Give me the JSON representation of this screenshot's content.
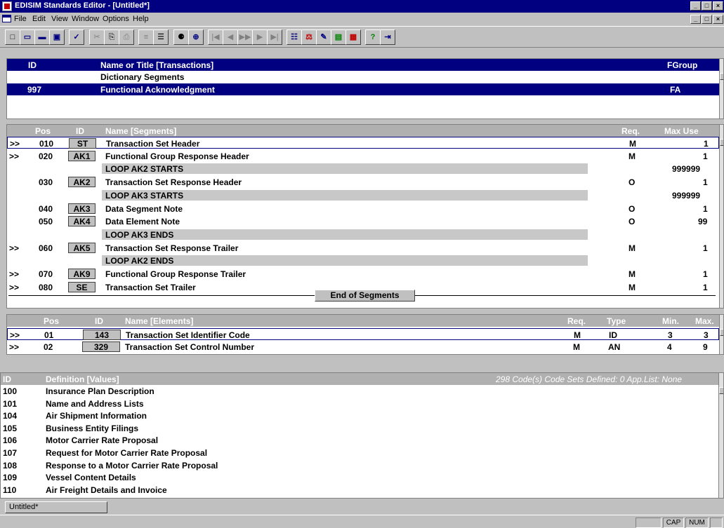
{
  "window": {
    "title": "EDISIM  Standards Editor - [Untitled*]",
    "controls": [
      "_",
      "□",
      "×"
    ]
  },
  "menu": [
    "File",
    "Edit",
    "View",
    "Window",
    "Options",
    "Help"
  ],
  "toolbar": [
    {
      "name": "new-icon",
      "glyph": "□",
      "style": ""
    },
    {
      "name": "open-icon",
      "glyph": "▭",
      "style": "b"
    },
    {
      "name": "open-folder-icon",
      "glyph": "▬",
      "style": "b"
    },
    {
      "name": "save-icon",
      "glyph": "▣",
      "style": "b"
    },
    {
      "name": "spellcheck-icon",
      "glyph": "✓",
      "style": "b"
    },
    {
      "name": "cut-icon",
      "glyph": "✂",
      "style": "dim"
    },
    {
      "name": "copy-icon",
      "glyph": "⎘",
      "style": ""
    },
    {
      "name": "paste-icon",
      "glyph": "⎙",
      "style": "dim"
    },
    {
      "name": "insert-icon",
      "glyph": "≡",
      "style": "dim"
    },
    {
      "name": "properties-icon",
      "glyph": "☰",
      "style": ""
    },
    {
      "name": "find-icon",
      "glyph": "⚈",
      "style": ""
    },
    {
      "name": "zoom-icon",
      "glyph": "⊕",
      "style": "b"
    },
    {
      "name": "first-record-icon",
      "glyph": "|◀",
      "style": "dim"
    },
    {
      "name": "previous-record-icon",
      "glyph": "◀",
      "style": "dim"
    },
    {
      "name": "fast-forward-icon",
      "glyph": "▶▶",
      "style": "dim"
    },
    {
      "name": "next-record-icon",
      "glyph": "▶",
      "style": "dim"
    },
    {
      "name": "last-record-icon",
      "glyph": "▶|",
      "style": "dim"
    },
    {
      "name": "segment-list-icon",
      "glyph": "☷",
      "style": "b"
    },
    {
      "name": "compare-icon",
      "glyph": "⚖",
      "style": "r"
    },
    {
      "name": "edit-icon",
      "glyph": "✎",
      "style": "b"
    },
    {
      "name": "document-icon",
      "glyph": "▤",
      "style": "g"
    },
    {
      "name": "report-icon",
      "glyph": "▦",
      "style": "r"
    },
    {
      "name": "help-icon",
      "glyph": "?",
      "style": "g"
    },
    {
      "name": "exit-icon",
      "glyph": "⇥",
      "style": "b"
    }
  ],
  "transactions": {
    "headers": {
      "id": "ID",
      "name": "Name or Title [Transactions]",
      "fgroup": "FGroup"
    },
    "rows": [
      {
        "id": "",
        "name": "Dictionary Segments",
        "fgroup": ""
      },
      {
        "id": "997",
        "name": "Functional Acknowledgment",
        "fgroup": "FA"
      }
    ]
  },
  "segments": {
    "headers": {
      "pos": "Pos",
      "id": "ID",
      "name": "Name [Segments]",
      "req": "Req.",
      "max": "Max Use"
    },
    "rows": [
      {
        "mark": ">>",
        "pos": "010",
        "id": "ST",
        "name": "Transaction Set Header",
        "req": "M",
        "max": "1"
      },
      {
        "mark": ">>",
        "pos": "020",
        "id": "AK1",
        "name": "Functional Group Response Header",
        "req": "M",
        "max": "1"
      },
      {
        "mark": "",
        "pos": "",
        "id": "",
        "name": "LOOP AK2 STARTS",
        "req": "",
        "max": "999999",
        "loop": true
      },
      {
        "mark": "",
        "pos": "030",
        "id": "AK2",
        "name": "Transaction Set Response Header",
        "req": "O",
        "max": "1"
      },
      {
        "mark": "",
        "pos": "",
        "id": "",
        "name": "LOOP AK3 STARTS",
        "req": "",
        "max": "999999",
        "loop": true
      },
      {
        "mark": "",
        "pos": "040",
        "id": "AK3",
        "name": "Data Segment Note",
        "req": "O",
        "max": "1"
      },
      {
        "mark": "",
        "pos": "050",
        "id": "AK4",
        "name": "Data Element Note",
        "req": "O",
        "max": "99"
      },
      {
        "mark": "",
        "pos": "",
        "id": "",
        "name": "LOOP AK3 ENDS",
        "req": "",
        "max": "",
        "loop": true
      },
      {
        "mark": ">>",
        "pos": "060",
        "id": "AK5",
        "name": "Transaction Set Response Trailer",
        "req": "M",
        "max": "1"
      },
      {
        "mark": "",
        "pos": "",
        "id": "",
        "name": "LOOP AK2 ENDS",
        "req": "",
        "max": "",
        "loop": true
      },
      {
        "mark": ">>",
        "pos": "070",
        "id": "AK9",
        "name": "Functional Group Response Trailer",
        "req": "M",
        "max": "1"
      },
      {
        "mark": ">>",
        "pos": "080",
        "id": "SE",
        "name": "Transaction Set Trailer",
        "req": "M",
        "max": "1"
      }
    ],
    "end_label": "End of Segments"
  },
  "elements": {
    "headers": {
      "pos": "Pos",
      "id": "ID",
      "name": "Name [Elements]",
      "req": "Req.",
      "type": "Type",
      "min": "Min.",
      "max": "Max."
    },
    "rows": [
      {
        "mark": ">>",
        "pos": "01",
        "id": "143",
        "name": "Transaction Set Identifier Code",
        "req": "M",
        "type": "ID",
        "min": "3",
        "max": "3"
      },
      {
        "mark": ">>",
        "pos": "02",
        "id": "329",
        "name": "Transaction Set Control Number",
        "req": "M",
        "type": "AN",
        "min": "4",
        "max": "9"
      }
    ]
  },
  "values": {
    "headers": {
      "id": "ID",
      "definition": "Definition [Values]",
      "info": "298 Code(s)   Code Sets Defined: 0   App.List: None"
    },
    "rows": [
      {
        "id": "100",
        "def": "Insurance Plan Description"
      },
      {
        "id": "101",
        "def": "Name and Address Lists"
      },
      {
        "id": "104",
        "def": "Air Shipment Information"
      },
      {
        "id": "105",
        "def": "Business Entity Filings"
      },
      {
        "id": "106",
        "def": "Motor Carrier Rate Proposal"
      },
      {
        "id": "107",
        "def": "Request for Motor Carrier Rate Proposal"
      },
      {
        "id": "108",
        "def": "Response to a Motor Carrier Rate Proposal"
      },
      {
        "id": "109",
        "def": "Vessel Content Details"
      },
      {
        "id": "110",
        "def": "Air Freight Details and Invoice"
      }
    ]
  },
  "status": {
    "tab": "Untitled*",
    "cap": "CAP",
    "num": "NUM"
  }
}
